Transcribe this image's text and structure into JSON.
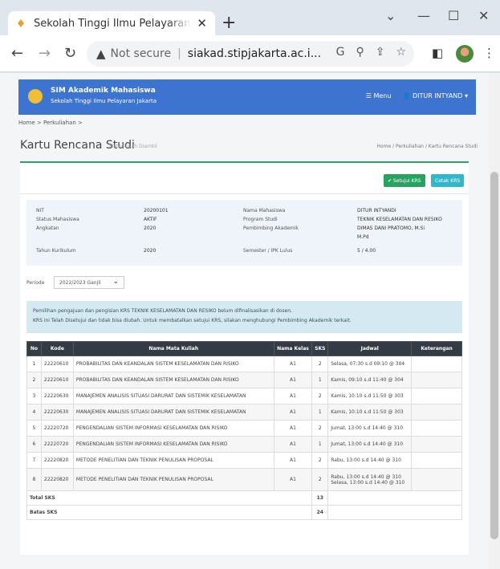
{
  "browser": {
    "tab_title": "Sekolah Tinggi Ilmu Pelayaran Ja",
    "tab_close": "✕",
    "new_tab": "+",
    "not_secure": "Not secure",
    "url": "siakad.stipjakarta.ac.i...",
    "controls": {
      "chevron": "⌄",
      "minimize": "—",
      "maximize": "☐",
      "close": "✕"
    }
  },
  "app": {
    "brand_title": "SIM Akademik Mahasiswa",
    "brand_subtitle": "Sekolah Tinggi Ilmu Pelayaran Jakarta",
    "menu_label": "Menu",
    "user_label": "DITUR INTYAND"
  },
  "breadcrumb": "Home  >  Perkuliahan  >",
  "page": {
    "title": "Kartu Rencana Studi",
    "subtitle": "Mata Kuliah Diambil",
    "crumb": "Home  /  Perkuliahan  /  Kartu Rencana Studi"
  },
  "actions": {
    "primary": "✔ Setujui KRS",
    "secondary": "Cetak KRS"
  },
  "info": {
    "left": [
      {
        "key": "NIT",
        "value": "20200101"
      },
      {
        "key": "Status Mahasiswa",
        "value": "AKTIF"
      },
      {
        "key": "Angkatan",
        "value": "2020"
      },
      {
        "key": "Tahun Kurikulum",
        "value": "2020"
      }
    ],
    "right": [
      {
        "key": "Nama Mahasiswa",
        "value": "DITUR INTYANDI"
      },
      {
        "key": "Program Studi",
        "value": "TEKNIK KESELAMATAN DAN RESIKO"
      },
      {
        "key": "Pembimbing Akademik",
        "value": "DIMAS DANI PRATOMO, M.Si",
        "value2": "M.Pd"
      },
      {
        "key": "Semester / IPK Lulus",
        "value": "5 / 4.00"
      }
    ]
  },
  "periode": {
    "label": "Periode",
    "value": "2022/2023 Ganjil"
  },
  "alert": {
    "line1": "Pemilihan pengajuan dan pengisian KRS TEKNIK KESELAMATAN DAN RESIKO belum difinalisasikan di dosen.",
    "line2": "KRS ini Telah Disetujui dan tidak bisa diubah. Untuk membatalkan setujui KRS, silakan menghubungi Pembimbing Akademik terkait."
  },
  "table": {
    "headers": [
      "No",
      "Kode",
      "Nama Mata Kuliah",
      "Nama Kelas",
      "SKS",
      "Jadwal",
      "Keterangan"
    ],
    "rows": [
      [
        "1",
        "22220610",
        "PROBABILITAS DAN KEANDALAN SISTEM KESELAMATAN DAN RISIKO",
        "A1",
        "2",
        "Selasa, 07:30 s.d 09:10 @ 304",
        ""
      ],
      [
        "2",
        "22220610",
        "PROBABILITAS DAN KEANDALAN SISTEM KESELAMATAN DAN RISIKO",
        "A1",
        "1",
        "Kamis, 09:10 s.d 11:40 @ 304",
        ""
      ],
      [
        "3",
        "22220630",
        "MANAJEMEN ANALISIS SITUASI DARURAT DAN SISTEMIK KESELAMATAN",
        "A1",
        "2",
        "Kamis, 10:10 s.d 11:50 @ 303",
        ""
      ],
      [
        "4",
        "22220630",
        "MANAJEMEN ANALISIS SITUASI DARURAT DAN SISTEMIK KESELAMATAN",
        "A1",
        "1",
        "Kamis, 10:10 s.d 11:50 @ 303",
        ""
      ],
      [
        "5",
        "22220720",
        "PENGENDALIAN SISTEM INFORMASI KESELAMATAN DAN RISIKO",
        "A1",
        "2",
        "Jumat, 13:00 s.d 14:40 @ 310",
        ""
      ],
      [
        "6",
        "22220720",
        "PENGENDALIAN SISTEM INFORMASI KESELAMATAN DAN RISIKO",
        "A1",
        "1",
        "Jumat, 13:00 s.d 14:40 @ 310",
        ""
      ],
      [
        "7",
        "22220820",
        "METODE PENELITIAN DAN TEKNIK PENULISAN PROPOSAL",
        "A1",
        "2",
        "Rabu, 13:00 s.d 14:40 @ 310",
        ""
      ],
      [
        "8",
        "22220820",
        "METODE PENELITIAN DAN TEKNIK PENULISAN PROPOSAL",
        "A1",
        "2",
        "Rabu, 13:00 s.d 14:40 @ 310",
        ""
      ]
    ],
    "row8_extra": "Selasa, 13:00 s.d 14:40 @ 310",
    "total_label": "Total SKS",
    "total_value": "13",
    "batas_label": "Batas SKS",
    "batas_value": "24"
  }
}
